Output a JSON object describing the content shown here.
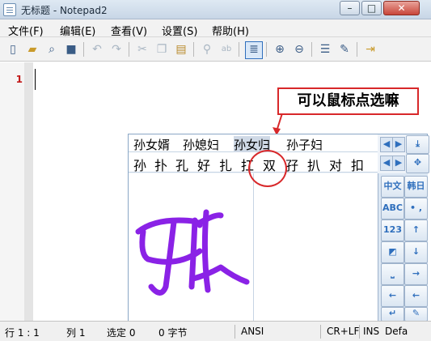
{
  "window": {
    "title": "无标题 - Notepad2",
    "min": "–",
    "max": "□",
    "close": "✕"
  },
  "menu": [
    "文件(F)",
    "编辑(E)",
    "查看(V)",
    "设置(S)",
    "帮助(H)"
  ],
  "toolbar": {
    "icons": [
      "new-file-icon",
      "open-folder-icon",
      "browse-icon",
      "save-icon",
      "undo-icon",
      "redo-icon",
      "cut-icon",
      "copy-icon",
      "paste-icon",
      "find-icon",
      "replace-icon",
      "word-wrap-icon",
      "zoom-in-icon",
      "zoom-out-icon",
      "scheme-icon",
      "customize-icon",
      "exit-icon"
    ]
  },
  "editor": {
    "line_number": "1"
  },
  "annotation": {
    "text": "可以鼠标点选嘛"
  },
  "ime": {
    "candidates_row1": [
      "孙女婿",
      "孙媳妇",
      "孙女归",
      "孙子妇"
    ],
    "candidates_row2": [
      "孙",
      "扑",
      "孔",
      "好",
      "扎",
      "扛",
      "双",
      "孖",
      "扒",
      "对",
      "扣"
    ],
    "buttons": [
      "中文",
      "韩日",
      "ABC",
      "• ,",
      "123",
      "↑",
      "◩",
      "↓",
      "⎵",
      "→",
      "←",
      "←",
      "↵",
      "✎"
    ],
    "handwriting_color": "#8a22e6"
  },
  "statusbar": {
    "position": "行 1 : 1",
    "column": "列 1",
    "selection": "选定 0",
    "bytes": "0 字节",
    "encoding": "ANSI",
    "line_ending": "CR+LF",
    "mode": "INS",
    "scheme": "Defa"
  }
}
